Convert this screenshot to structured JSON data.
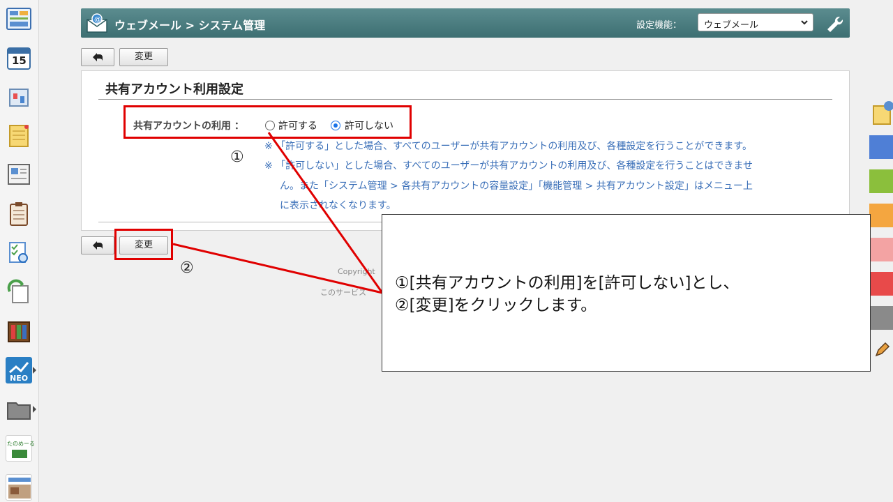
{
  "header": {
    "title": "ウェブメール > システム管理",
    "settings_label": "設定機能：",
    "settings_value": "ウェブメール"
  },
  "toolbar": {
    "change_label": "変更"
  },
  "panel": {
    "title": "共有アカウント利用設定",
    "usage_label": "共有アカウントの利用 ：",
    "options": [
      "許可する",
      "許可しない"
    ],
    "selected_option": "許可しない",
    "notes": [
      "※ 「許可する」とした場合、すべてのユーザーが共有アカウントの利用及び、各種設定を行うことができます。",
      "※ 「許可しない」とした場合、すべてのユーザーが共有アカウントの利用及び、各種設定を行うことはできませ",
      "ん。また「システム管理 > 各共有アカウントの容量設定」「機能管理 > 共有アカウント設定」はメニュー上",
      "に表示されなくなります。"
    ]
  },
  "footer": {
    "copyright": "Copyright",
    "service": "このサービス"
  },
  "annotation": {
    "marker_1": "①",
    "marker_2": "②",
    "line_1": "①[共有アカウントの利用]を[許可しない]とし、",
    "line_2": "②[変更]をクリックします。",
    "color": "#e00000"
  },
  "sidebar": {
    "apps": [
      "portal-icon",
      "calendar-icon",
      "facility-icon",
      "memo-icon",
      "bulletin-icon",
      "report-icon",
      "search-icon",
      "workflow-icon",
      "cabinet-icon",
      "neo-icon",
      "folder-icon",
      "tanomail-icon",
      "banner-icon"
    ],
    "calendar_day": "15",
    "neo_text": "NEO",
    "tanomail_text": "たのめーる"
  },
  "palette": {
    "colors": [
      "#4f7fd6",
      "#8bbf3c",
      "#f4a640",
      "#f3a3a3",
      "#e84a4a",
      "#8a8a8a"
    ]
  }
}
